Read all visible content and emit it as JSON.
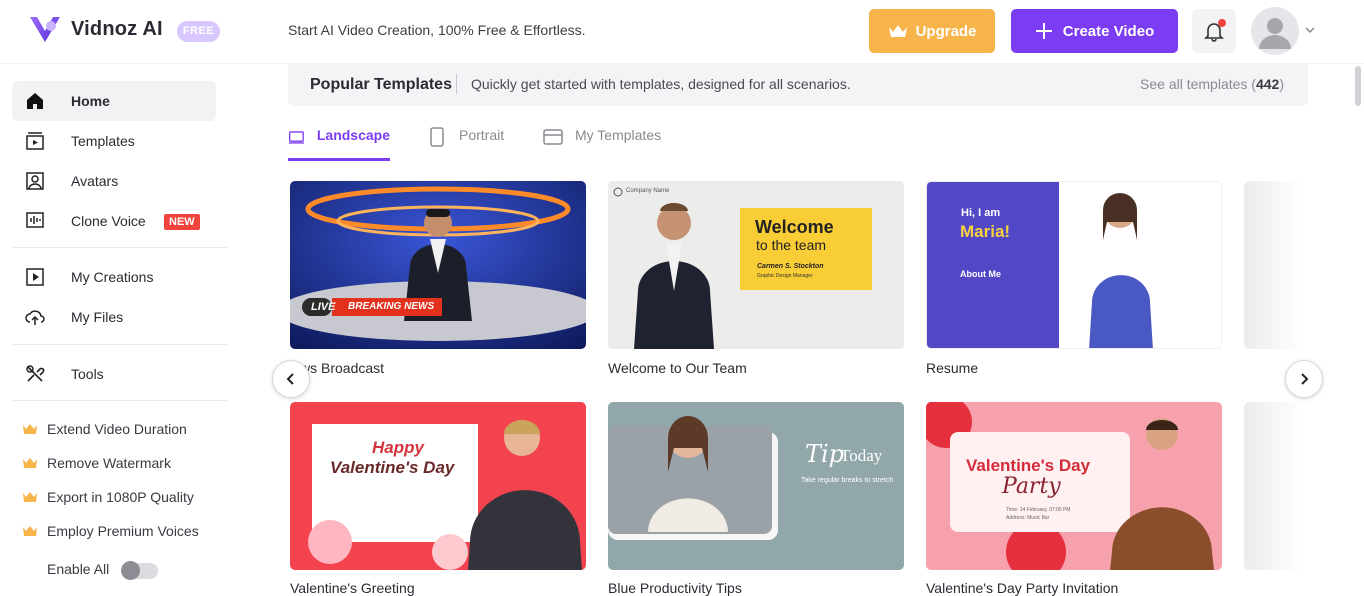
{
  "header": {
    "brand": "Vidnoz AI",
    "plan_badge": "FREE",
    "tagline": "Start AI Video Creation, 100% Free & Effortless.",
    "upgrade_label": "Upgrade",
    "create_label": "Create Video",
    "colors": {
      "upgrade": "#f6b44b",
      "create": "#7b3cf2",
      "notification_dot": "#f0443d"
    }
  },
  "sidebar": {
    "items": [
      {
        "label": "Home",
        "icon": "home-icon",
        "active": true
      },
      {
        "label": "Templates",
        "icon": "templates-icon"
      },
      {
        "label": "Avatars",
        "icon": "avatar-icon"
      },
      {
        "label": "Clone Voice",
        "icon": "voice-wave-icon",
        "badge": "NEW"
      },
      {
        "label": "My Creations",
        "icon": "play-box-icon"
      },
      {
        "label": "My Files",
        "icon": "cloud-upload-icon"
      },
      {
        "label": "Tools",
        "icon": "tools-icon"
      }
    ],
    "perks": [
      "Extend Video Duration",
      "Remove Watermark",
      "Export in 1080P Quality",
      "Employ Premium Voices"
    ],
    "enable_all_label": "Enable All",
    "enable_all_on": false
  },
  "main": {
    "section_title": "Popular Templates",
    "section_desc": "Quickly get started with templates, designed for all scenarios.",
    "see_all_prefix": "See all templates (",
    "see_all_count": "442",
    "see_all_suffix": ")",
    "tabs": [
      {
        "label": "Landscape",
        "active": true
      },
      {
        "label": "Portrait"
      },
      {
        "label": "My Templates"
      }
    ],
    "templates": [
      {
        "title": "ws Broadcast",
        "overlay": {
          "live": "LIVE",
          "breaking": "BREAKING NEWS"
        }
      },
      {
        "title": "Welcome to Our Team",
        "overlay": {
          "line1": "Welcome",
          "line2": "to the team",
          "name": "Carmen S. Stockton",
          "role": "Graphic Design Manager",
          "company": "Company Name"
        }
      },
      {
        "title": "Resume",
        "overlay": {
          "hi": "Hi, I am",
          "name": "Maria!",
          "about": "About Me"
        }
      },
      {
        "title": "Valentine's Greeting",
        "overlay": {
          "line1": "Happy",
          "line2": "Valentine's Day"
        }
      },
      {
        "title": "Blue Productivity Tips",
        "overlay": {
          "tip": "Tip",
          "today": "Today",
          "sub": "Take regular breaks to stretch"
        }
      },
      {
        "title": "Valentine's Day Party Invitation",
        "overlay": {
          "line1": "Valentine's Day",
          "line2": "Party",
          "time": "Time: 14 February, 07:00 PM",
          "address": "Address: Music Bar"
        }
      }
    ]
  }
}
